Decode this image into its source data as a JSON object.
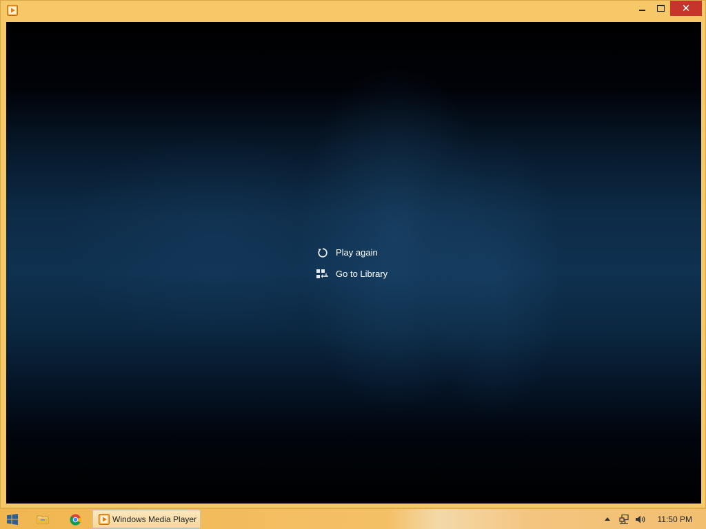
{
  "window": {
    "minimize_label": "",
    "maximize_label": "",
    "close_label": "✕"
  },
  "player": {
    "play_again_label": "Play again",
    "go_to_library_label": "Go to Library"
  },
  "taskbar": {
    "active_task_label": "Windows Media Player",
    "clock": "11:50 PM"
  },
  "colors": {
    "title_bar": "#f6c867",
    "close_button": "#c7342b",
    "video_background": "#0f3150"
  }
}
